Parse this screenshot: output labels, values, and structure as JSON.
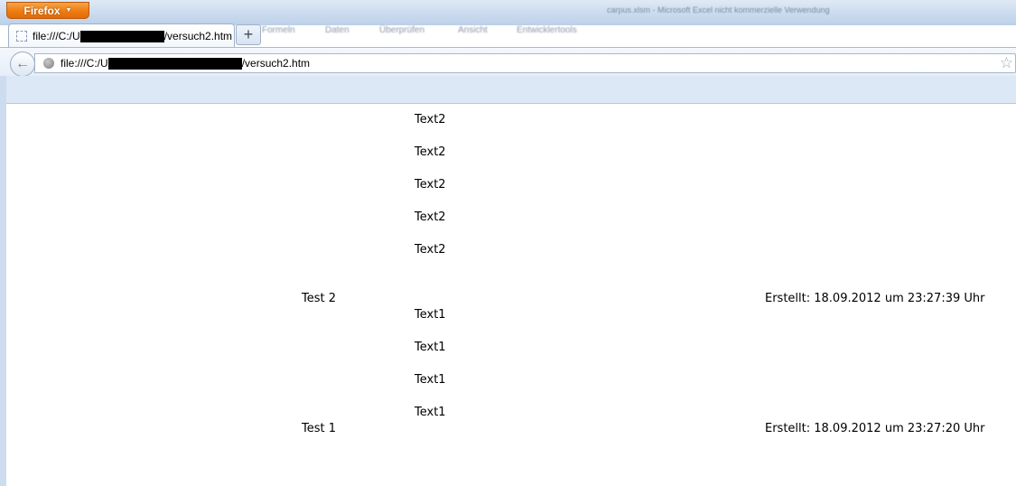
{
  "app": {
    "menu_button_label": "Firefox",
    "blurred_window_title": "carpus.xlsm - Microsoft Excel nicht kommerzielle Verwendung",
    "blurred_ribbon_items": [
      "Formeln",
      "Daten",
      "Überprüfen",
      "Ansicht",
      "Entwicklertools"
    ]
  },
  "tab": {
    "title_prefix": "file:///C:/U",
    "title_suffix": "/versuch2.htm",
    "new_tab_label": "+"
  },
  "navbar": {
    "back_label": "←",
    "url_prefix": "file:///C:/U",
    "url_suffix": "/versuch2.htm",
    "star_label": "☆"
  },
  "content": {
    "text2_rows": [
      "Text2",
      "Text2",
      "Text2",
      "Text2",
      "Text2"
    ],
    "test2": {
      "name": "Test 2",
      "created": "Erstellt: 18.09.2012 um 23:27:39 Uhr"
    },
    "text1_rows": [
      "Text1",
      "Text1",
      "Text1",
      "Text1"
    ],
    "test1": {
      "name": "Test 1",
      "created": "Erstellt: 18.09.2012 um 23:27:20 Uhr"
    }
  },
  "colors": {
    "firefox_orange": "#ee7c13",
    "chrome_blue": "#dde8f6"
  }
}
